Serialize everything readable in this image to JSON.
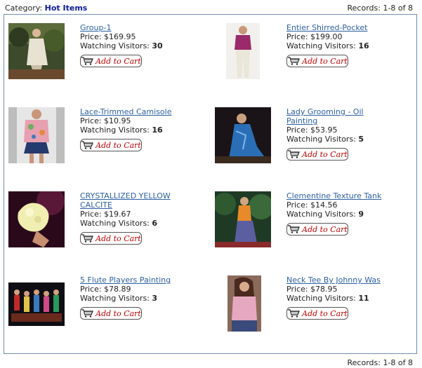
{
  "header": {
    "category_label": "Category:",
    "category_name": "Hot Items",
    "records": "Records: 1-8 of 8"
  },
  "footer": {
    "records": "Records: 1-8 of 8"
  },
  "cart_label": "Add to Cart",
  "price_prefix": "Price:",
  "watching_label": "Watching Visitors:",
  "products": [
    {
      "title": "Group-1",
      "title_line2": "",
      "price": "$169.95",
      "watching": "30",
      "image": "woman-in-garden-photo"
    },
    {
      "title": "Entier Shirred-Pocket",
      "title_line2": "",
      "price": "$199.00",
      "watching": "16",
      "image": "woman-pink-top-white-pants-photo"
    },
    {
      "title": "Lace-Trimmed Camisole",
      "title_line2": "",
      "price": "$10.95",
      "watching": "16",
      "image": "woman-floral-jacket-denim-skirt-photo"
    },
    {
      "title": "Lady Grooming - Oil",
      "title_line2": "Painting",
      "price": "$53.95",
      "watching": "5",
      "image": "lady-blue-dress-painting"
    },
    {
      "title": "CRYSTALLIZED YELLOW",
      "title_line2": "CALCITE",
      "price": "$19.67",
      "watching": "6",
      "image": "yellow-calcite-crystal-photo"
    },
    {
      "title": "Clementine Texture Tank",
      "title_line2": "",
      "price": "$14.56",
      "watching": "9",
      "image": "woman-orange-tank-garden-photo"
    },
    {
      "title": "5 Flute Players Painting",
      "title_line2": "",
      "price": "$78.89",
      "watching": "3",
      "image": "flute-players-painting"
    },
    {
      "title": "Neck Tee By Johnny Was",
      "title_line2": "",
      "price": "$78.95",
      "watching": "11",
      "image": "woman-pink-tee-photo"
    }
  ]
}
